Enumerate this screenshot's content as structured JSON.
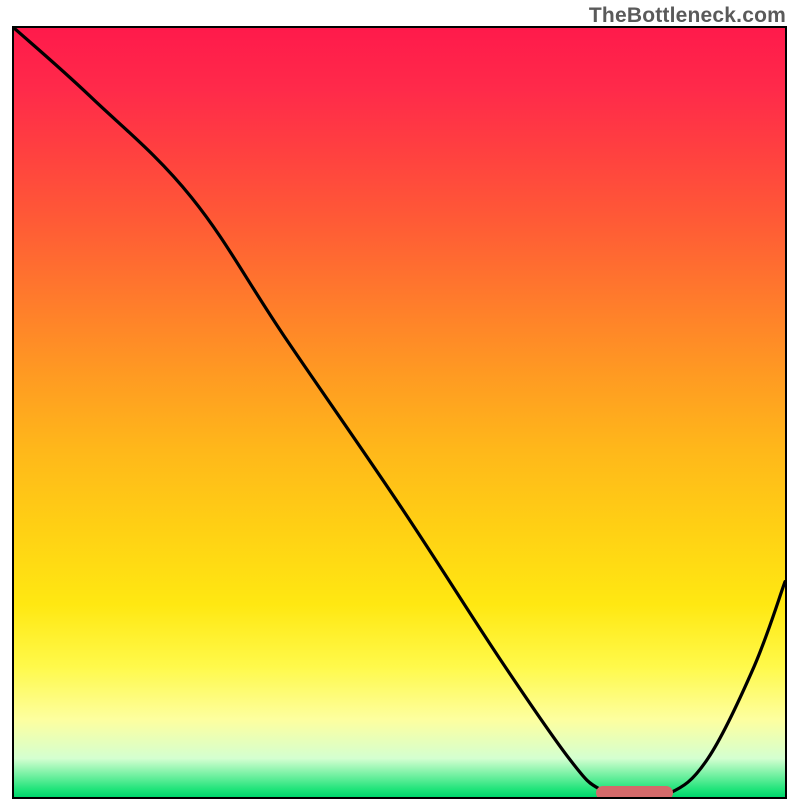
{
  "attribution": "TheBottleneck.com",
  "chart_data": {
    "type": "line",
    "title": "",
    "xlabel": "",
    "ylabel": "",
    "xlim": [
      0,
      100
    ],
    "ylim": [
      0,
      100
    ],
    "grid": false,
    "legend": false,
    "series": [
      {
        "name": "bottleneck-curve",
        "x": [
          0,
          10,
          23,
          35,
          50,
          63,
          72,
          76,
          80,
          85,
          90,
          96,
          100
        ],
        "values": [
          100,
          91,
          78,
          60,
          38,
          18,
          5,
          1,
          0.5,
          0.5,
          5,
          17,
          28
        ]
      }
    ],
    "background_gradient": {
      "top": "#ff1a4b",
      "mid": "#ffe812",
      "bottom": "#00d66c"
    },
    "optimal_marker": {
      "x_start": 76,
      "x_end": 85,
      "y": 0.5,
      "color": "#d46a6a"
    }
  }
}
